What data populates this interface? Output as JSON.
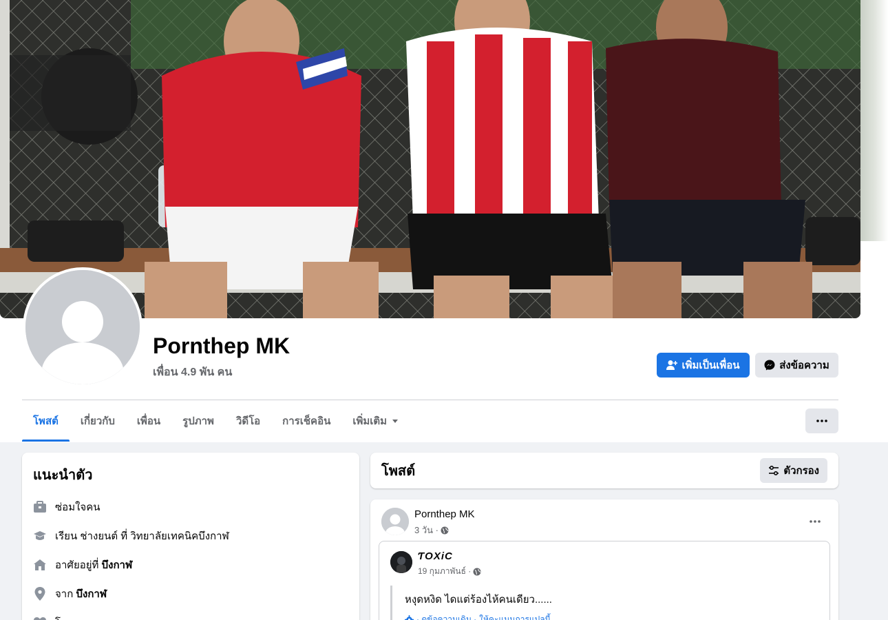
{
  "profile": {
    "name": "Pornthep MK",
    "friends": "เพื่อน 4.9 พัน คน",
    "add_friend_label": "เพิ่มเป็นเพื่อน",
    "message_label": "ส่งข้อความ"
  },
  "tabs": [
    {
      "label": "โพสต์",
      "active": true
    },
    {
      "label": "เกี่ยวกับ"
    },
    {
      "label": "เพื่อน"
    },
    {
      "label": "รูปภาพ"
    },
    {
      "label": "วิดีโอ"
    },
    {
      "label": "การเช็คอิน"
    },
    {
      "label": "เพิ่มเติม"
    }
  ],
  "intro": {
    "title": "แนะนำตัว",
    "items": [
      {
        "icon": "briefcase-icon",
        "text": "ซ่อมใจคน"
      },
      {
        "icon": "graduation-cap-icon",
        "text": "เรียน ช่างยนต์ ที่ วิทยาลัยเทคนิคบึงกาฬ"
      },
      {
        "icon": "home-icon",
        "prefix": "อาศัยอยู่ที่ ",
        "bold": "บึงกาฬ"
      },
      {
        "icon": "location-pin-icon",
        "prefix": "จาก ",
        "bold": "บึงกาฬ"
      },
      {
        "icon": "heart-icon",
        "text": "โสด"
      }
    ]
  },
  "posts_header": {
    "title": "โพสต์",
    "filter_label": "ตัวกรอง"
  },
  "post": {
    "author": "Pornthep MK",
    "time": "3 วัน ·",
    "shared": {
      "author": "ƬOXiC",
      "time": "19 กุมภาพันธ์ ·",
      "text": "หงุดหงิด ไดแต่ร้องไห้คนเดียว......",
      "see_original": "· ดูข้อความเดิม ·",
      "rate_translation": "ให้คะแนนการแปลนี้"
    }
  },
  "colors": {
    "accent": "#1b74e4",
    "muted_text": "#65676b",
    "button_gray": "#e4e6eb"
  }
}
